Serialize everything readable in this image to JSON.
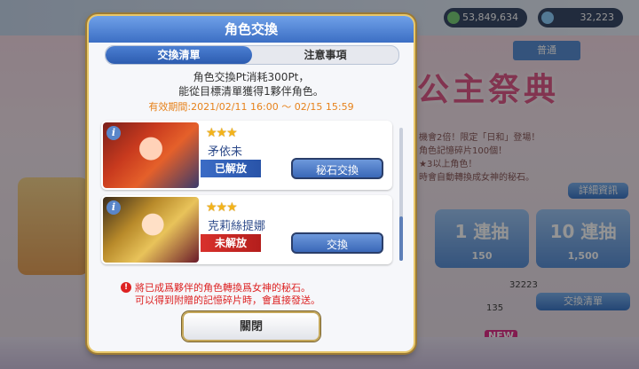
{
  "background": {
    "top_resources": [
      {
        "value": "53,849,634",
        "color": "#7ad07a"
      },
      {
        "value": "32,223",
        "color": "#8fd0ff"
      }
    ],
    "tabs": [
      "普通"
    ],
    "banner": "公主祭典",
    "banner_lines": [
      "機會2倍！限定「日和」登場！",
      "角色記憶碎片100個！",
      "★3以上角色！",
      "時會自動轉換成女神的秘石。"
    ],
    "detail_button": "詳細資訊",
    "gacha_single": {
      "label": "1 連抽",
      "cost": "150"
    },
    "gacha_ten": {
      "label": "10 連抽",
      "cost": "1,500"
    },
    "count_line": "32223",
    "count_small": "135",
    "exchange_list_button": "交換清單",
    "new_badge": "NEW"
  },
  "dialog": {
    "title": "角色交換",
    "tabs": {
      "active": "交換清單",
      "inactive": "注意事項"
    },
    "desc_line1": "角色交換Pt消耗300Pt，",
    "desc_line2": "能從目標清單獲得1夥伴角色。",
    "period_label": "有效期間:",
    "period_value": "2021/02/11 16:00 ～ 02/15 15:59",
    "characters": [
      {
        "stars": "★★★",
        "name": "矛依未",
        "status": "已解放",
        "status_color": "#3b6cc6",
        "button": "秘石交換",
        "info_icon": "i"
      },
      {
        "stars": "★★★",
        "name": "克莉絲提娜",
        "status": "未解放",
        "status_color": "#d8312c",
        "button": "交換",
        "info_icon": "i"
      }
    ],
    "warning_line1": "將已成爲夥伴的角色轉換爲女神的秘石。",
    "warning_line2": "可以得到附贈的記憶碎片時，會直接發送。",
    "warning_icon": "!",
    "close_button": "關閉"
  }
}
